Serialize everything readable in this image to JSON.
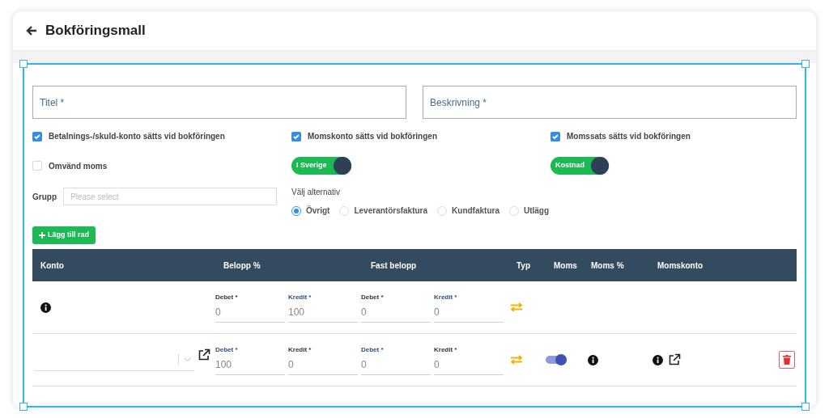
{
  "header": {
    "title": "Bokföringsmall"
  },
  "text_fields": [
    {
      "placeholder": "Titel *"
    },
    {
      "placeholder": "Beskrivning *"
    }
  ],
  "checkboxes": [
    {
      "label": "Betalnings-/skuld-konto sätts vid bokföringen",
      "checked": true
    },
    {
      "label": "Momskonto sätts vid bokföringen",
      "checked": true
    },
    {
      "label": "Momssats sätts vid bokföringen",
      "checked": true
    }
  ],
  "reverse_vat": {
    "label": "Omvänd moms",
    "checked": false
  },
  "toggles": [
    {
      "label": "I Sverige",
      "on": true
    },
    {
      "label": "Kostnad",
      "on": true
    }
  ],
  "group": {
    "label": "Grupp",
    "placeholder": "Please select"
  },
  "options": {
    "label": "Välj alternativ",
    "items": [
      {
        "label": "Övrigt",
        "selected": true
      },
      {
        "label": "Leverantörsfaktura",
        "selected": false
      },
      {
        "label": "Kundfaktura",
        "selected": false
      },
      {
        "label": "Utlägg",
        "selected": false
      }
    ]
  },
  "add_row_button": {
    "label": "Lägg till rad"
  },
  "table": {
    "columns": [
      "Konto",
      "Belopp %",
      "Fast belopp",
      "Typ",
      "Moms",
      "Moms %",
      "Momskonto"
    ],
    "rows": [
      {
        "kind": "fixed",
        "amounts": [
          {
            "label": "Debet *",
            "value": "0",
            "highlighted": false
          },
          {
            "label": "Kredit *",
            "value": "100",
            "highlighted": true
          },
          {
            "label": "Debet *",
            "value": "0",
            "highlighted": false
          },
          {
            "label": "Kredit *",
            "value": "0",
            "highlighted": true
          }
        ]
      },
      {
        "kind": "editable",
        "amounts": [
          {
            "label": "Debet *",
            "value": "100",
            "highlighted": true
          },
          {
            "label": "Kredit *",
            "value": "0",
            "highlighted": false
          },
          {
            "label": "Debet *",
            "value": "0",
            "highlighted": true
          },
          {
            "label": "Kredit *",
            "value": "0",
            "highlighted": false
          }
        ],
        "vat_on": true
      }
    ]
  }
}
